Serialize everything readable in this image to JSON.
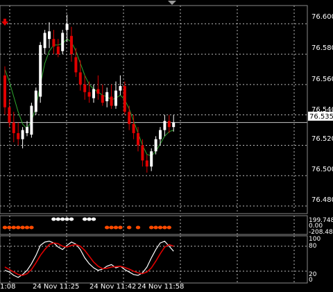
{
  "colors": {
    "background": "#000000",
    "grid": "#bdbdbd",
    "bull_candle": "#ffffff",
    "bear_candle": "#e00000",
    "ma_line": "#2ea82e",
    "stoch_main": "#ffffff",
    "stoch_signal": "#e00000",
    "signal_dot_white": "#ffffff",
    "signal_dot_orange": "#ff4a00",
    "current_price_line": "#c8c8c8"
  },
  "icons": {
    "sell_arrow": "red-down-arrow-icon",
    "shift_marker": "grey-triangle-icon"
  },
  "price_axis": {
    "ticks": [
      "76.600",
      "76.580",
      "76.560",
      "76.540",
      "76.520",
      "76.500",
      "76.480"
    ],
    "current_price": "76.535"
  },
  "signal_axis": {
    "labels": [
      "199.7483",
      "0.00",
      "-208.4813"
    ]
  },
  "stoch_axis": {
    "ticks": [
      "100",
      "80",
      "20",
      "0"
    ]
  },
  "time_axis": {
    "labels": [
      "1:08",
      "24 Nov 11:25",
      "24 Nov 11:42",
      "24 Nov 11:58"
    ]
  },
  "chart_data": [
    {
      "type": "candlestick",
      "ylim": [
        76.475,
        76.612
      ],
      "y_ticks": [
        76.48,
        76.5,
        76.52,
        76.54,
        76.56,
        76.58,
        76.6
      ],
      "current_price": 76.535,
      "x_labels": [
        "1:08",
        "24 Nov 11:25",
        "24 Nov 11:42",
        "24 Nov 11:58"
      ],
      "candles": [
        {
          "o": 76.566,
          "h": 76.572,
          "l": 76.54,
          "c": 76.545
        },
        {
          "o": 76.545,
          "h": 76.55,
          "l": 76.532,
          "c": 76.535
        },
        {
          "o": 76.535,
          "h": 76.542,
          "l": 76.522,
          "c": 76.528
        },
        {
          "o": 76.528,
          "h": 76.535,
          "l": 76.52,
          "c": 76.524
        },
        {
          "o": 76.524,
          "h": 76.532,
          "l": 76.518,
          "c": 76.53
        },
        {
          "o": 76.528,
          "h": 76.536,
          "l": 76.526,
          "c": 76.532
        },
        {
          "o": 76.527,
          "h": 76.548,
          "l": 76.525,
          "c": 76.546
        },
        {
          "o": 76.542,
          "h": 76.558,
          "l": 76.54,
          "c": 76.556
        },
        {
          "o": 76.552,
          "h": 76.588,
          "l": 76.548,
          "c": 76.586
        },
        {
          "o": 76.584,
          "h": 76.596,
          "l": 76.58,
          "c": 76.594
        },
        {
          "o": 76.59,
          "h": 76.601,
          "l": 76.584,
          "c": 76.595
        },
        {
          "o": 76.59,
          "h": 76.596,
          "l": 76.58,
          "c": 76.585
        },
        {
          "o": 76.585,
          "h": 76.59,
          "l": 76.578,
          "c": 76.58
        },
        {
          "o": 76.582,
          "h": 76.596,
          "l": 76.58,
          "c": 76.594
        },
        {
          "o": 76.596,
          "h": 76.606,
          "l": 76.588,
          "c": 76.6
        },
        {
          "o": 76.592,
          "h": 76.598,
          "l": 76.575,
          "c": 76.58
        },
        {
          "o": 76.578,
          "h": 76.584,
          "l": 76.565,
          "c": 76.568
        },
        {
          "o": 76.568,
          "h": 76.576,
          "l": 76.556,
          "c": 76.56
        },
        {
          "o": 76.56,
          "h": 76.566,
          "l": 76.55,
          "c": 76.555
        },
        {
          "o": 76.555,
          "h": 76.562,
          "l": 76.548,
          "c": 76.552
        },
        {
          "o": 76.551,
          "h": 76.56,
          "l": 76.548,
          "c": 76.557
        },
        {
          "o": 76.557,
          "h": 76.566,
          "l": 76.55,
          "c": 76.554
        },
        {
          "o": 76.553,
          "h": 76.56,
          "l": 76.546,
          "c": 76.548
        },
        {
          "o": 76.549,
          "h": 76.558,
          "l": 76.545,
          "c": 76.555
        },
        {
          "o": 76.552,
          "h": 76.56,
          "l": 76.544,
          "c": 76.546
        },
        {
          "o": 76.546,
          "h": 76.562,
          "l": 76.544,
          "c": 76.556
        },
        {
          "o": 76.556,
          "h": 76.566,
          "l": 76.553,
          "c": 76.559
        },
        {
          "o": 76.559,
          "h": 76.562,
          "l": 76.54,
          "c": 76.542
        },
        {
          "o": 76.542,
          "h": 76.546,
          "l": 76.53,
          "c": 76.534
        },
        {
          "o": 76.534,
          "h": 76.54,
          "l": 76.524,
          "c": 76.528
        },
        {
          "o": 76.528,
          "h": 76.532,
          "l": 76.516,
          "c": 76.52
        },
        {
          "o": 76.52,
          "h": 76.524,
          "l": 76.506,
          "c": 76.51
        },
        {
          "o": 76.51,
          "h": 76.514,
          "l": 76.502,
          "c": 76.506
        },
        {
          "o": 76.506,
          "h": 76.518,
          "l": 76.503,
          "c": 76.516
        },
        {
          "o": 76.516,
          "h": 76.526,
          "l": 76.514,
          "c": 76.524
        },
        {
          "o": 76.524,
          "h": 76.532,
          "l": 76.52,
          "c": 76.53
        },
        {
          "o": 76.53,
          "h": 76.54,
          "l": 76.526,
          "c": 76.536
        },
        {
          "o": 76.536,
          "h": 76.54,
          "l": 76.528,
          "c": 76.532
        },
        {
          "o": 76.532,
          "h": 76.54,
          "l": 76.529,
          "c": 76.535
        }
      ],
      "ma": [
        76.57,
        76.562,
        76.552,
        76.542,
        76.534,
        76.531,
        76.536,
        76.545,
        76.56,
        76.574,
        76.582,
        76.586,
        76.586,
        76.587,
        76.59,
        76.588,
        76.582,
        76.574,
        76.566,
        76.56,
        76.557,
        76.555,
        76.553,
        76.552,
        76.55,
        76.551,
        76.553,
        76.55,
        76.544,
        76.536,
        76.528,
        76.52,
        76.514,
        76.513,
        76.516,
        76.521,
        76.526,
        76.529,
        76.53
      ]
    },
    {
      "type": "dots",
      "ylim": [
        -208.4813,
        199.7483
      ],
      "white_candle_indices": [
        11,
        12,
        13,
        14,
        15,
        18,
        19,
        20
      ],
      "orange_candle_indices": [
        0,
        1,
        2,
        3,
        4,
        5,
        6,
        23,
        24,
        25,
        26,
        28,
        30,
        33,
        34,
        35,
        36,
        37
      ]
    },
    {
      "type": "line",
      "ylim": [
        0,
        100
      ],
      "series": [
        {
          "values": [
            22,
            18,
            10,
            5,
            12,
            22,
            38,
            58,
            82,
            90,
            92,
            88,
            78,
            72,
            82,
            90,
            85,
            72,
            52,
            38,
            28,
            22,
            25,
            32,
            36,
            28,
            32,
            24,
            18,
            12,
            10,
            16,
            30,
            52,
            72,
            88,
            92,
            80,
            68
          ]
        },
        {
          "values": [
            30,
            24,
            18,
            12,
            10,
            14,
            24,
            40,
            58,
            72,
            84,
            88,
            86,
            80,
            78,
            82,
            84,
            80,
            70,
            56,
            42,
            32,
            26,
            27,
            30,
            31,
            32,
            29,
            25,
            20,
            16,
            14,
            18,
            28,
            44,
            62,
            78,
            84,
            80
          ]
        }
      ]
    }
  ]
}
